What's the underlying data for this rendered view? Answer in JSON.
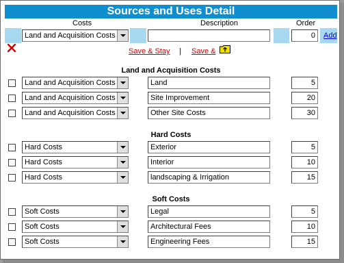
{
  "title": "Sources and Uses Detail",
  "columns": {
    "costs": "Costs",
    "description": "Description",
    "order": "Order"
  },
  "new_row": {
    "category": "Land and Acquisition Costs",
    "description": "",
    "order": "0",
    "add_label": "Add"
  },
  "actions": {
    "save_stay_label": "Save & Stay",
    "separator": "|",
    "save_close_label": "Save &"
  },
  "icons": {
    "delete": "red-x-icon",
    "save_close": "folder-up-icon"
  },
  "colors": {
    "header_bg": "#0f8fcf",
    "add_row_bg": "#a8d8f0",
    "link": "#cc0000",
    "add_link": "#0000ee"
  },
  "sections": [
    {
      "heading": "Land and Acquisition Costs",
      "rows": [
        {
          "category": "Land and Acquisition Costs",
          "description": "Land",
          "order": "5"
        },
        {
          "category": "Land and Acquisition Costs",
          "description": "Site Improvement",
          "order": "20"
        },
        {
          "category": "Land and Acquisition Costs",
          "description": "Other Site Costs",
          "order": "30"
        }
      ]
    },
    {
      "heading": "Hard Costs",
      "rows": [
        {
          "category": "Hard Costs",
          "description": "Exterior",
          "order": "5"
        },
        {
          "category": "Hard Costs",
          "description": "Interior",
          "order": "10"
        },
        {
          "category": "Hard Costs",
          "description": "landscaping & Irrigation",
          "order": "15"
        }
      ]
    },
    {
      "heading": "Soft Costs",
      "rows": [
        {
          "category": "Soft Costs",
          "description": "Legal",
          "order": "5"
        },
        {
          "category": "Soft Costs",
          "description": "Architectural Fees",
          "order": "10"
        },
        {
          "category": "Soft Costs",
          "description": "Engineering Fees",
          "order": "15"
        }
      ]
    }
  ]
}
